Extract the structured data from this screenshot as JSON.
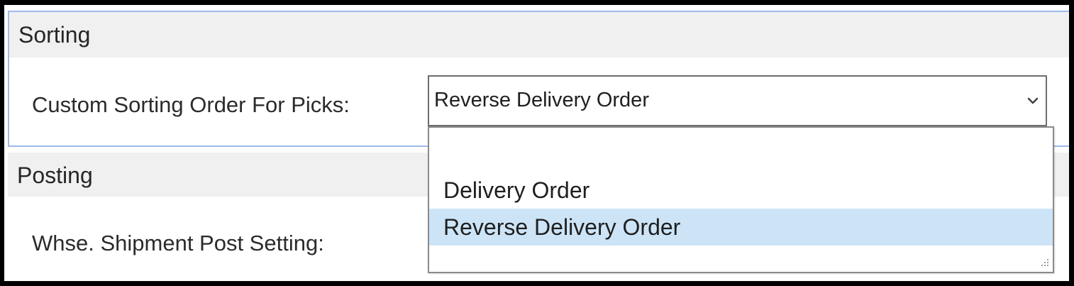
{
  "sorting": {
    "title": "Sorting",
    "field_label": "Custom Sorting Order For Picks:",
    "selected_value": "Reverse Delivery Order",
    "options": [
      {
        "label": "",
        "selected": false
      },
      {
        "label": "Delivery Order",
        "selected": false
      },
      {
        "label": "Reverse Delivery Order",
        "selected": true
      }
    ]
  },
  "posting": {
    "title": "Posting",
    "field_label": "Whse. Shipment Post Setting:"
  },
  "colors": {
    "section_header_bg": "#f0f0f0",
    "section_border": "#9dbbea",
    "selected_option_bg": "#cde4f7"
  },
  "icons": {
    "dropdown_toggle": "chevron-down-icon",
    "resize_grip": "resize-grip-icon"
  }
}
